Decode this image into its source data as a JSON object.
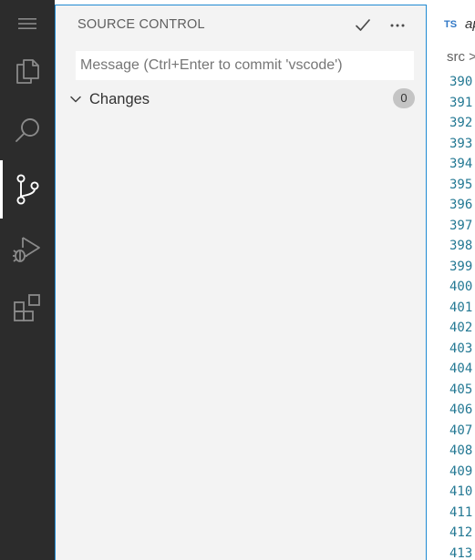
{
  "activity_bar": {
    "items": [
      {
        "name": "explorer",
        "icon": "files-icon"
      },
      {
        "name": "search",
        "icon": "search-icon"
      },
      {
        "name": "source-control",
        "icon": "source-control-icon",
        "active": true
      },
      {
        "name": "run-and-debug",
        "icon": "run-debug-icon"
      },
      {
        "name": "extensions",
        "icon": "extensions-icon"
      }
    ]
  },
  "sidebar": {
    "title": "SOURCE CONTROL",
    "commit_icon": "checkmark-icon",
    "more_icon": "ellipsis-icon",
    "message_placeholder": "Message (Ctrl+Enter to commit 'vscode')",
    "changes_label": "Changes",
    "changes_count": "0"
  },
  "editor": {
    "tab_lang": "TS",
    "tab_name": "ap",
    "breadcrumb": "src >",
    "line_numbers": [
      "390",
      "391",
      "392",
      "393",
      "394",
      "395",
      "396",
      "397",
      "398",
      "399",
      "400",
      "401",
      "402",
      "403",
      "404",
      "405",
      "406",
      "407",
      "408",
      "409",
      "410",
      "411",
      "412",
      "413"
    ]
  },
  "colors": {
    "activity_bg": "#2c2c2c",
    "sidebar_bg": "#f3f3f3",
    "focus_border": "#1f8ad2",
    "line_number": "#237893",
    "ts_blue": "#3178c6"
  }
}
